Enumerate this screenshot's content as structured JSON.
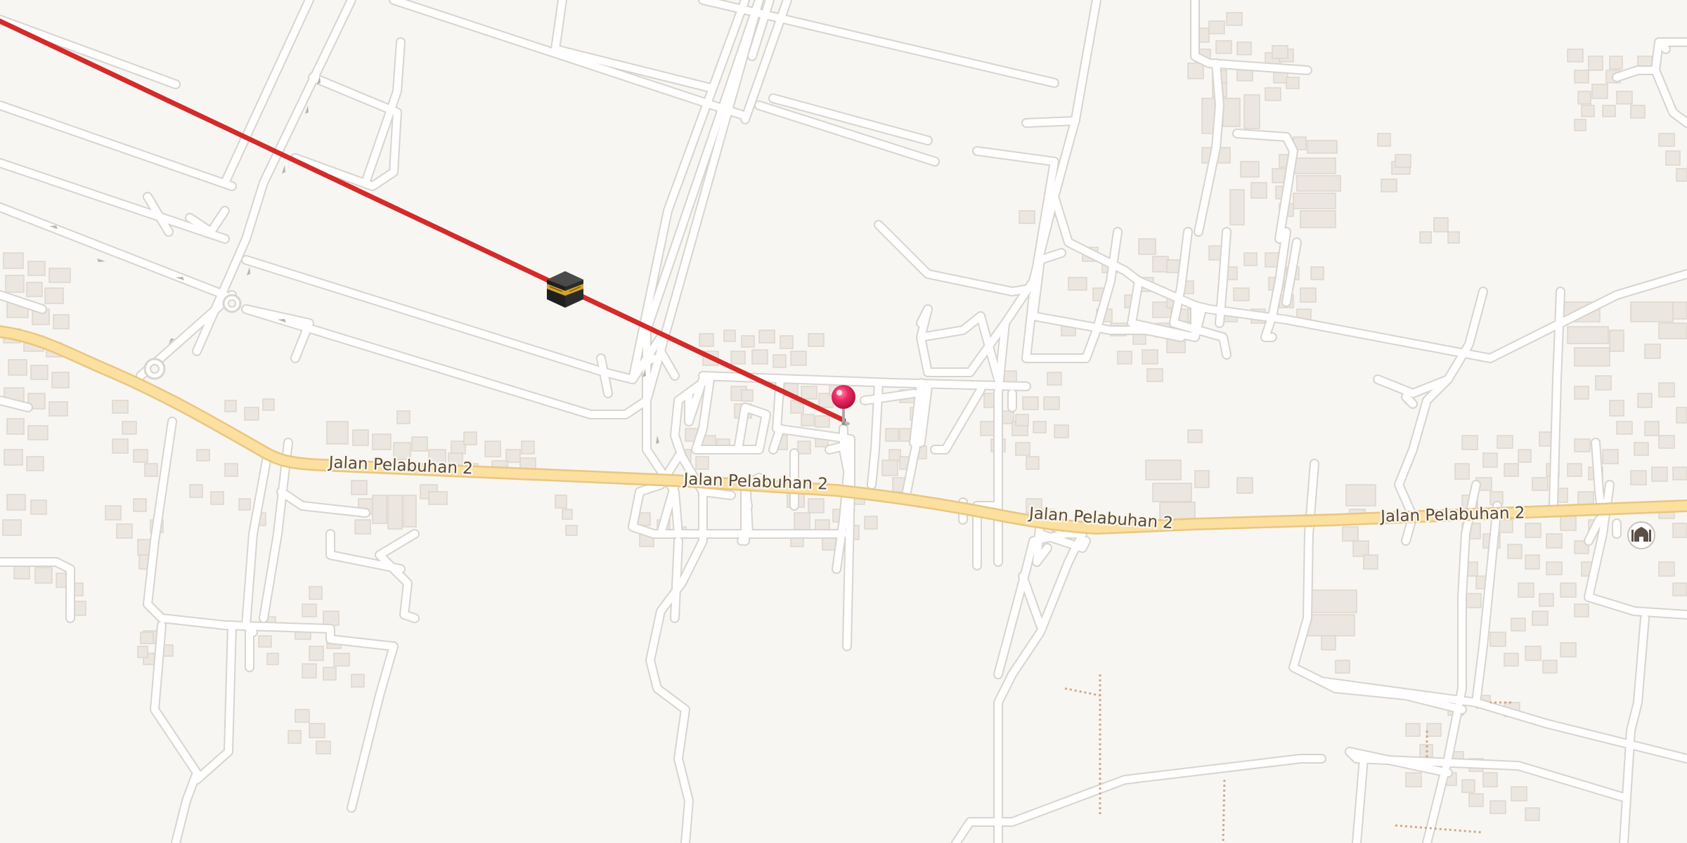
{
  "map": {
    "street_labels": [
      {
        "text": "Jalan Pelabuhan 2"
      },
      {
        "text": "Jalan Pelabuhan 2"
      },
      {
        "text": "Jalan Pelabuhan 2"
      },
      {
        "text": "Jalan Pelabuhan 2"
      }
    ],
    "icons": {
      "kaaba": "kaaba-icon",
      "pin": "location-pin-icon",
      "mosque": "mosque-icon"
    },
    "colors": {
      "background": "#f8f6f2",
      "minor_road": "#ffffff",
      "road_casing": "#dcd8d2",
      "main_road": "#fbe0a0",
      "main_road_casing": "#e9c681",
      "building": "#ebe6df",
      "qibla_line": "#d42a2a",
      "pin": "#e8205a"
    }
  }
}
